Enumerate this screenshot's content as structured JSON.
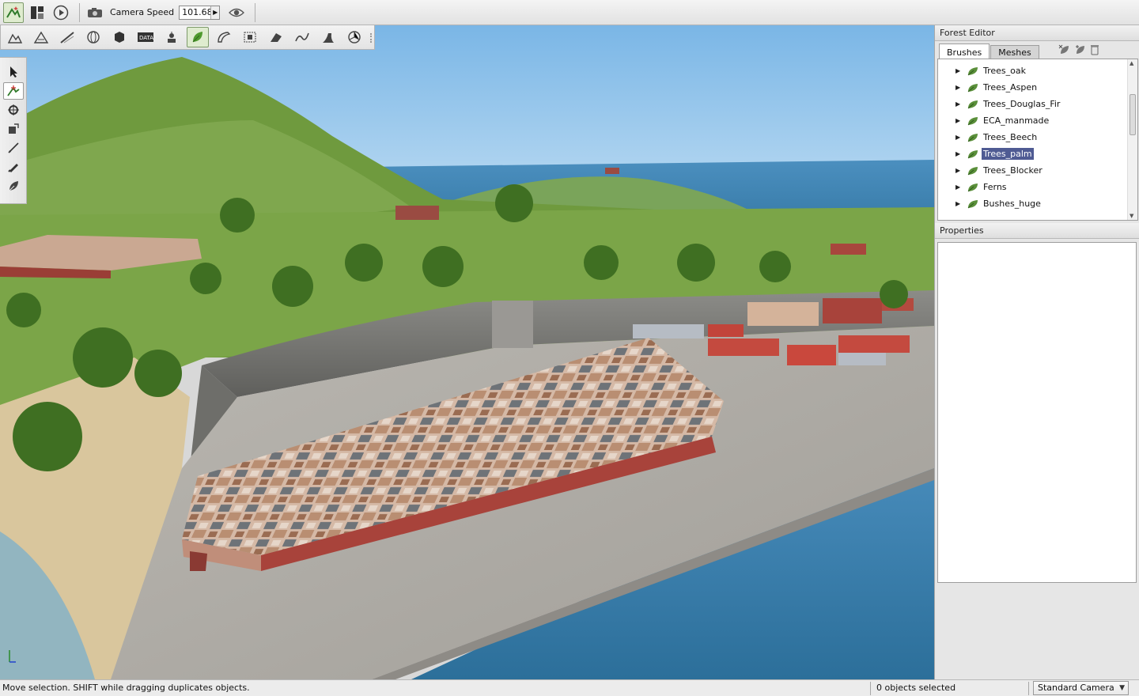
{
  "toolbar": {
    "camera_speed_label": "Camera Speed",
    "camera_speed_value": "101.68",
    "icons": [
      "world-editor-icon",
      "layout-icon",
      "play-icon",
      "camera-icon",
      "eye-icon"
    ]
  },
  "tools": {
    "icons": [
      "terrain-editor-icon",
      "terrain-painter-icon",
      "road-editor-icon",
      "sky-globe-icon",
      "object-editor-icon",
      "datablock-editor-icon",
      "particle-editor-icon",
      "forest-editor-icon",
      "decal-editor-icon",
      "mesh-road-icon",
      "river-editor-icon",
      "convex-editor-icon",
      "decal-road-icon",
      "shape-editor-icon"
    ]
  },
  "palette": {
    "icons": [
      "select-arrow-icon",
      "move-brush-icon",
      "rotate-icon",
      "scale-icon",
      "paint-brush-icon",
      "erase-brush-icon",
      "erase-selected-icon"
    ]
  },
  "forest_editor": {
    "title": "Forest Editor",
    "tabs": [
      {
        "label": "Brushes",
        "selected": true
      },
      {
        "label": "Meshes",
        "selected": false
      }
    ],
    "brushes": [
      {
        "label": "Trees_oak",
        "selected": false
      },
      {
        "label": "Trees_Aspen",
        "selected": false
      },
      {
        "label": "Trees_Douglas_Fir",
        "selected": false
      },
      {
        "label": "ECA_manmade",
        "selected": false
      },
      {
        "label": "Trees_Beech",
        "selected": false
      },
      {
        "label": "Trees_palm",
        "selected": true
      },
      {
        "label": "Trees_Blocker",
        "selected": false
      },
      {
        "label": "Ferns",
        "selected": false
      },
      {
        "label": "Bushes_huge",
        "selected": false
      }
    ]
  },
  "properties": {
    "title": "Properties"
  },
  "status": {
    "message": "Move selection.  SHIFT while dragging duplicates objects.",
    "selection_count": "0 objects selected",
    "camera_mode": "Standard Camera"
  },
  "colors": {
    "selection": "#4f5b93",
    "active_tool": "#dfeccf",
    "sky": "#8fc3ea",
    "sea": "#3f7fa8",
    "grass": "#6f9a3e",
    "concrete": "#a9a6a0",
    "roof": "#c9a896",
    "wall_red": "#a8433b"
  }
}
